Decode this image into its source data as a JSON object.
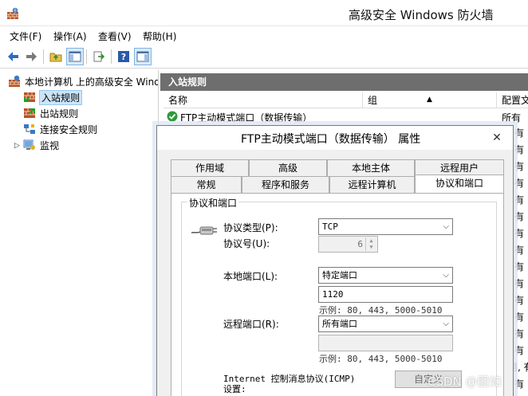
{
  "window": {
    "title": "高级安全 Windows 防火墙"
  },
  "menu": [
    "文件(F)",
    "操作(A)",
    "查看(V)",
    "帮助(H)"
  ],
  "toolbar": {
    "buttons": [
      "back-icon",
      "forward-icon",
      "up-folder-icon",
      "show-hide-tree-icon",
      "export-icon",
      "help-icon",
      "action-pane-icon"
    ]
  },
  "tree": {
    "root": "本地计算机 上的高级安全 Windows",
    "items": [
      "入站规则",
      "出站规则",
      "连接安全规则",
      "监视"
    ]
  },
  "content": {
    "header": "入站规则",
    "columns": [
      "名称",
      "组",
      "配置文"
    ],
    "rows": [
      {
        "name": "FTP主动模式端口（数据传输）",
        "profile": "所有"
      }
    ],
    "right_edge_fragments": [
      "有",
      "有",
      "有",
      "有",
      "有",
      "有",
      "有",
      "有",
      "有",
      "有",
      "有",
      "有",
      "有",
      "有",
      "用, 有",
      "有"
    ]
  },
  "dialog": {
    "title": "FTP主动模式端口（数据传输） 属性",
    "tabs_row1": [
      "作用域",
      "高级",
      "本地主体",
      "远程用户"
    ],
    "tabs_row2": [
      "常规",
      "程序和服务",
      "远程计算机",
      "协议和端口"
    ],
    "group_title": "协议和端口",
    "protocol_type_label": "协议类型(P):",
    "protocol_type_value": "TCP",
    "protocol_number_label": "协议号(U):",
    "protocol_number_value": "6",
    "local_port_label": "本地端口(L):",
    "local_port_value": "特定端口",
    "local_port_text": "1120",
    "local_example": "示例: 80, 443, 5000-5010",
    "remote_port_label": "远程端口(R):",
    "remote_port_value": "所有端口",
    "remote_port_text": "",
    "remote_example": "示例: 80, 443, 5000-5010",
    "icmp_label": "Internet 控制消息协议(ICMP)设置:",
    "custom_button": "自定义"
  },
  "watermark": "CSDN @图如",
  "colors": {
    "section_header_bg": "#6e6e6e",
    "selection": "#cce4f7",
    "accept_green": "#2e9a3a"
  }
}
